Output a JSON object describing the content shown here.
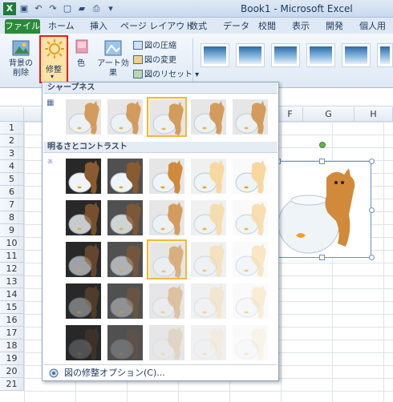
{
  "window": {
    "title": "Book1 - Microsoft Excel"
  },
  "tabs": {
    "file": "ファイル",
    "home": "ホーム",
    "insert": "挿入",
    "layout": "ページ レイアウト",
    "formulas": "数式",
    "data": "データ",
    "review": "校閲",
    "view": "表示",
    "developer": "開発",
    "personal": "個人用"
  },
  "ribbon": {
    "remove_bg": "背景の\n削除",
    "corrections": "修整",
    "color": "色",
    "artistic": "アート効果",
    "compress": "図の圧縮",
    "change": "図の変更",
    "reset": "図のリセット"
  },
  "grid": {
    "columns": [
      "F",
      "G",
      "H"
    ],
    "rows": [
      "1",
      "2",
      "3",
      "4",
      "5",
      "6",
      "7",
      "8",
      "9",
      "10",
      "11",
      "12",
      "13",
      "14",
      "15",
      "16",
      "17",
      "18",
      "19",
      "20",
      "21"
    ]
  },
  "gallery": {
    "sharpness_title": "シャープネス",
    "brightness_title": "明るさとコントラスト",
    "options_link": "図の修整オプション(C)..."
  },
  "colors": {
    "accent_red": "#e02020",
    "selected_thumb": "#f0b840",
    "file_tab": "#2a8a3a"
  }
}
